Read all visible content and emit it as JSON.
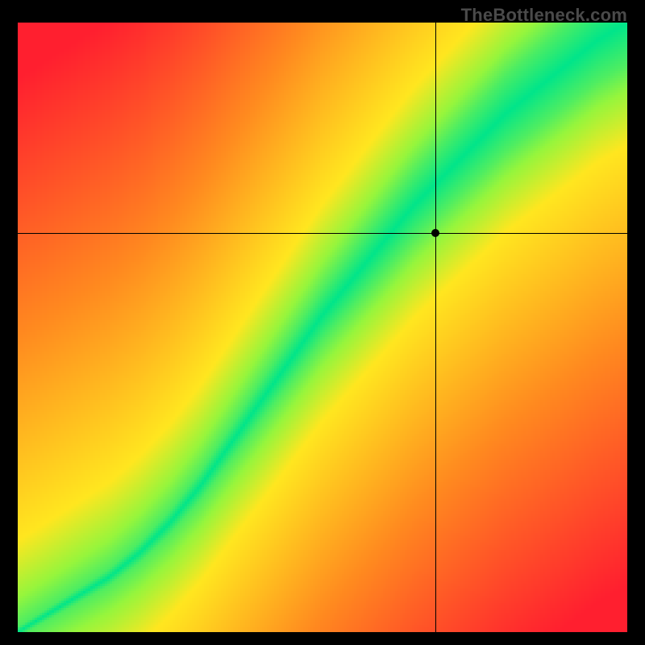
{
  "watermark": "TheBottleneck.com",
  "chart_data": {
    "type": "heatmap",
    "title": "",
    "xlabel": "",
    "ylabel": "",
    "xlim": [
      0,
      1
    ],
    "ylim": [
      0,
      1
    ],
    "crosshair": {
      "x": 0.685,
      "y": 0.655
    },
    "marker": {
      "x": 0.685,
      "y": 0.655
    },
    "optimal_curve_note": "Green diagonal band represents no-bottleneck region; red corners indicate severe bottleneck.",
    "color_scale": {
      "red": "#ff1f2f",
      "orange": "#ff8a1f",
      "yellow": "#ffe61f",
      "yellowgreen": "#b8ff1f",
      "green": "#00e58a"
    },
    "band": {
      "description": "Approximate center of the green band as y = f(x) sampled across x in [0,1].",
      "x": [
        0.0,
        0.05,
        0.1,
        0.15,
        0.2,
        0.25,
        0.3,
        0.35,
        0.4,
        0.45,
        0.5,
        0.55,
        0.6,
        0.65,
        0.7,
        0.75,
        0.8,
        0.85,
        0.9,
        0.95,
        1.0
      ],
      "y": [
        0.0,
        0.03,
        0.06,
        0.09,
        0.13,
        0.18,
        0.24,
        0.31,
        0.38,
        0.45,
        0.52,
        0.58,
        0.64,
        0.7,
        0.75,
        0.8,
        0.85,
        0.89,
        0.93,
        0.97,
        1.0
      ],
      "half_width": [
        0.008,
        0.01,
        0.012,
        0.014,
        0.017,
        0.02,
        0.024,
        0.028,
        0.033,
        0.037,
        0.041,
        0.045,
        0.049,
        0.052,
        0.055,
        0.058,
        0.061,
        0.063,
        0.065,
        0.067,
        0.069
      ]
    }
  }
}
